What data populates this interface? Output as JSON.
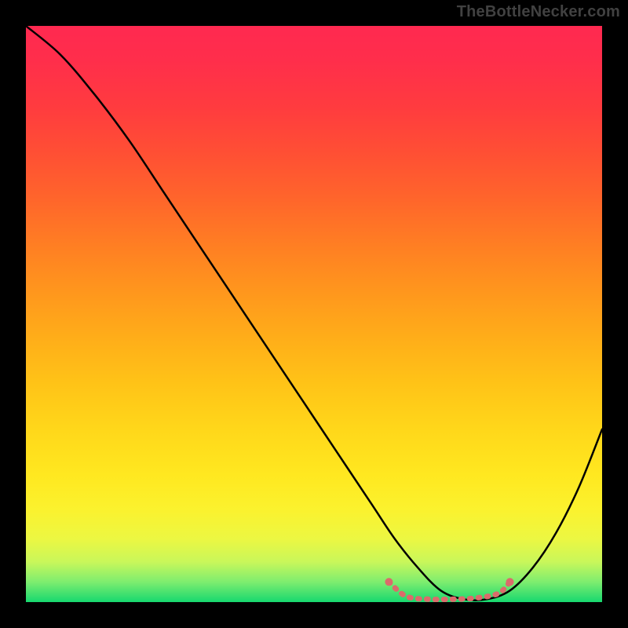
{
  "watermark": "TheBottleNecker.com",
  "chart_data": {
    "type": "line",
    "title": "",
    "xlabel": "",
    "ylabel": "",
    "xlim": [
      0,
      100
    ],
    "ylim": [
      0,
      100
    ],
    "series": [
      {
        "name": "curve",
        "color": "#000000",
        "x": [
          0,
          6,
          12,
          18,
          24,
          30,
          36,
          42,
          48,
          54,
          60,
          64,
          68,
          72,
          76,
          80,
          84,
          88,
          92,
          96,
          100
        ],
        "y": [
          100,
          95,
          88,
          80,
          71,
          62,
          53,
          44,
          35,
          26,
          17,
          11,
          6,
          2,
          0.5,
          0.5,
          2,
          6,
          12,
          20,
          30
        ]
      },
      {
        "name": "optimal-band",
        "color": "#db6b6b",
        "x": [
          63,
          66,
          70,
          74,
          78,
          82,
          84
        ],
        "y": [
          3.5,
          1,
          0.5,
          0.5,
          0.7,
          1.5,
          3.5
        ]
      }
    ],
    "gradient_stops": [
      {
        "offset": 0.0,
        "color": "#ff2950"
      },
      {
        "offset": 0.06,
        "color": "#ff2e4b"
      },
      {
        "offset": 0.14,
        "color": "#ff3b3f"
      },
      {
        "offset": 0.22,
        "color": "#ff4f34"
      },
      {
        "offset": 0.3,
        "color": "#ff652b"
      },
      {
        "offset": 0.38,
        "color": "#ff7e23"
      },
      {
        "offset": 0.46,
        "color": "#ff961d"
      },
      {
        "offset": 0.54,
        "color": "#ffad19"
      },
      {
        "offset": 0.62,
        "color": "#ffc317"
      },
      {
        "offset": 0.7,
        "color": "#ffd71a"
      },
      {
        "offset": 0.78,
        "color": "#ffe820"
      },
      {
        "offset": 0.84,
        "color": "#fbf22e"
      },
      {
        "offset": 0.89,
        "color": "#ecf742"
      },
      {
        "offset": 0.93,
        "color": "#c9f75a"
      },
      {
        "offset": 0.965,
        "color": "#7eed6f"
      },
      {
        "offset": 1.0,
        "color": "#17d86f"
      }
    ]
  }
}
